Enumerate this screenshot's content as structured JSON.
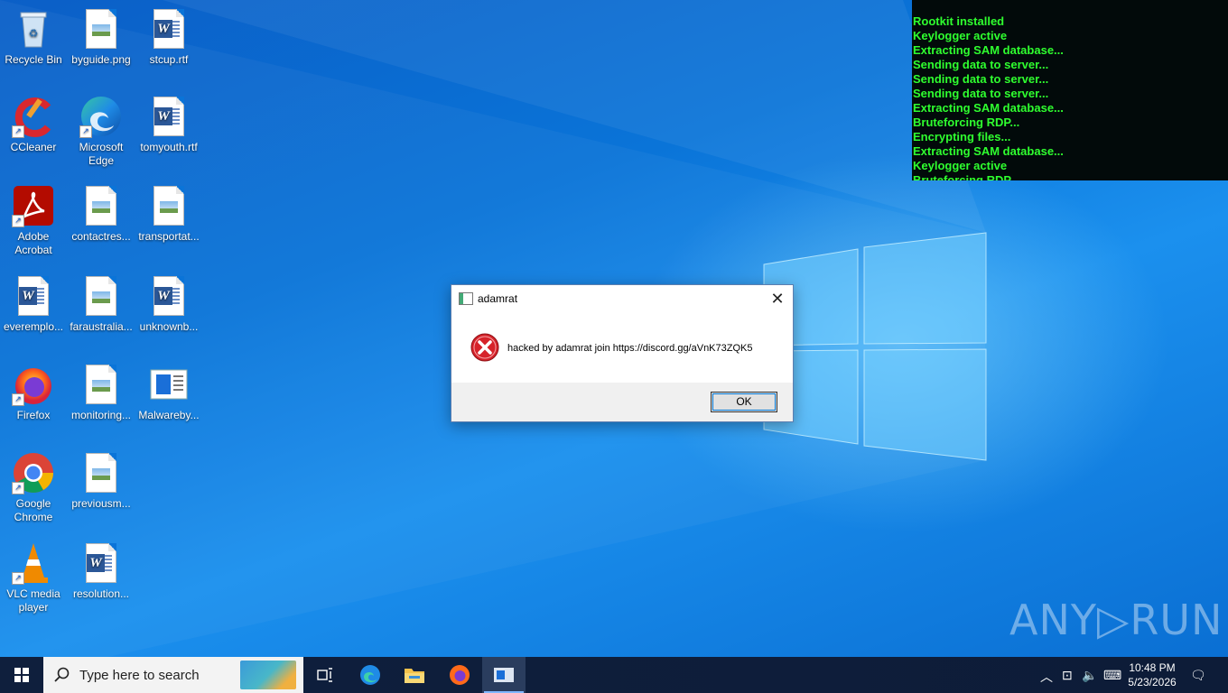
{
  "desktop": {
    "icons": [
      {
        "label": "Recycle Bin"
      },
      {
        "label": "byguide.png"
      },
      {
        "label": "stcup.rtf"
      },
      {
        "label": "CCleaner"
      },
      {
        "label": "Microsoft Edge"
      },
      {
        "label": "tomyouth.rtf"
      },
      {
        "label": "Adobe Acrobat"
      },
      {
        "label": "contactres..."
      },
      {
        "label": "transportat..."
      },
      {
        "label": "everemplo..."
      },
      {
        "label": "faraustralia..."
      },
      {
        "label": "unknownb..."
      },
      {
        "label": "Firefox"
      },
      {
        "label": "monitoring..."
      },
      {
        "label": "Malwareby..."
      },
      {
        "label": "Google Chrome"
      },
      {
        "label": "previousm..."
      },
      {
        "label": "VLC media player"
      },
      {
        "label": "resolution..."
      }
    ]
  },
  "console": {
    "lines": [
      "Rootkit installed",
      "Keylogger active",
      "Extracting SAM database...",
      "Sending data to server...",
      "Sending data to server...",
      "Sending data to server...",
      "Extracting SAM database...",
      "Bruteforcing RDP...",
      "Encrypting files...",
      "Extracting SAM database...",
      "Keylogger active",
      "Bruteforcing RDP..."
    ],
    "color": "#2fff2f"
  },
  "dialog": {
    "title": "adamrat",
    "message": "hacked by adamrat join https://discord.gg/aVnK73ZQK5",
    "ok_label": "OK",
    "close_glyph": "✕"
  },
  "watermark": {
    "text": "ANY▷RUN"
  },
  "taskbar": {
    "search_placeholder": "Type here to search",
    "time": "10:48 PM",
    "date": "5/23/2026",
    "apps": [
      "task-view",
      "microsoft-edge",
      "file-explorer",
      "firefox",
      "adamrat"
    ]
  },
  "colors": {
    "accent": "#0078d7",
    "taskbar": "#0f1f3d"
  }
}
